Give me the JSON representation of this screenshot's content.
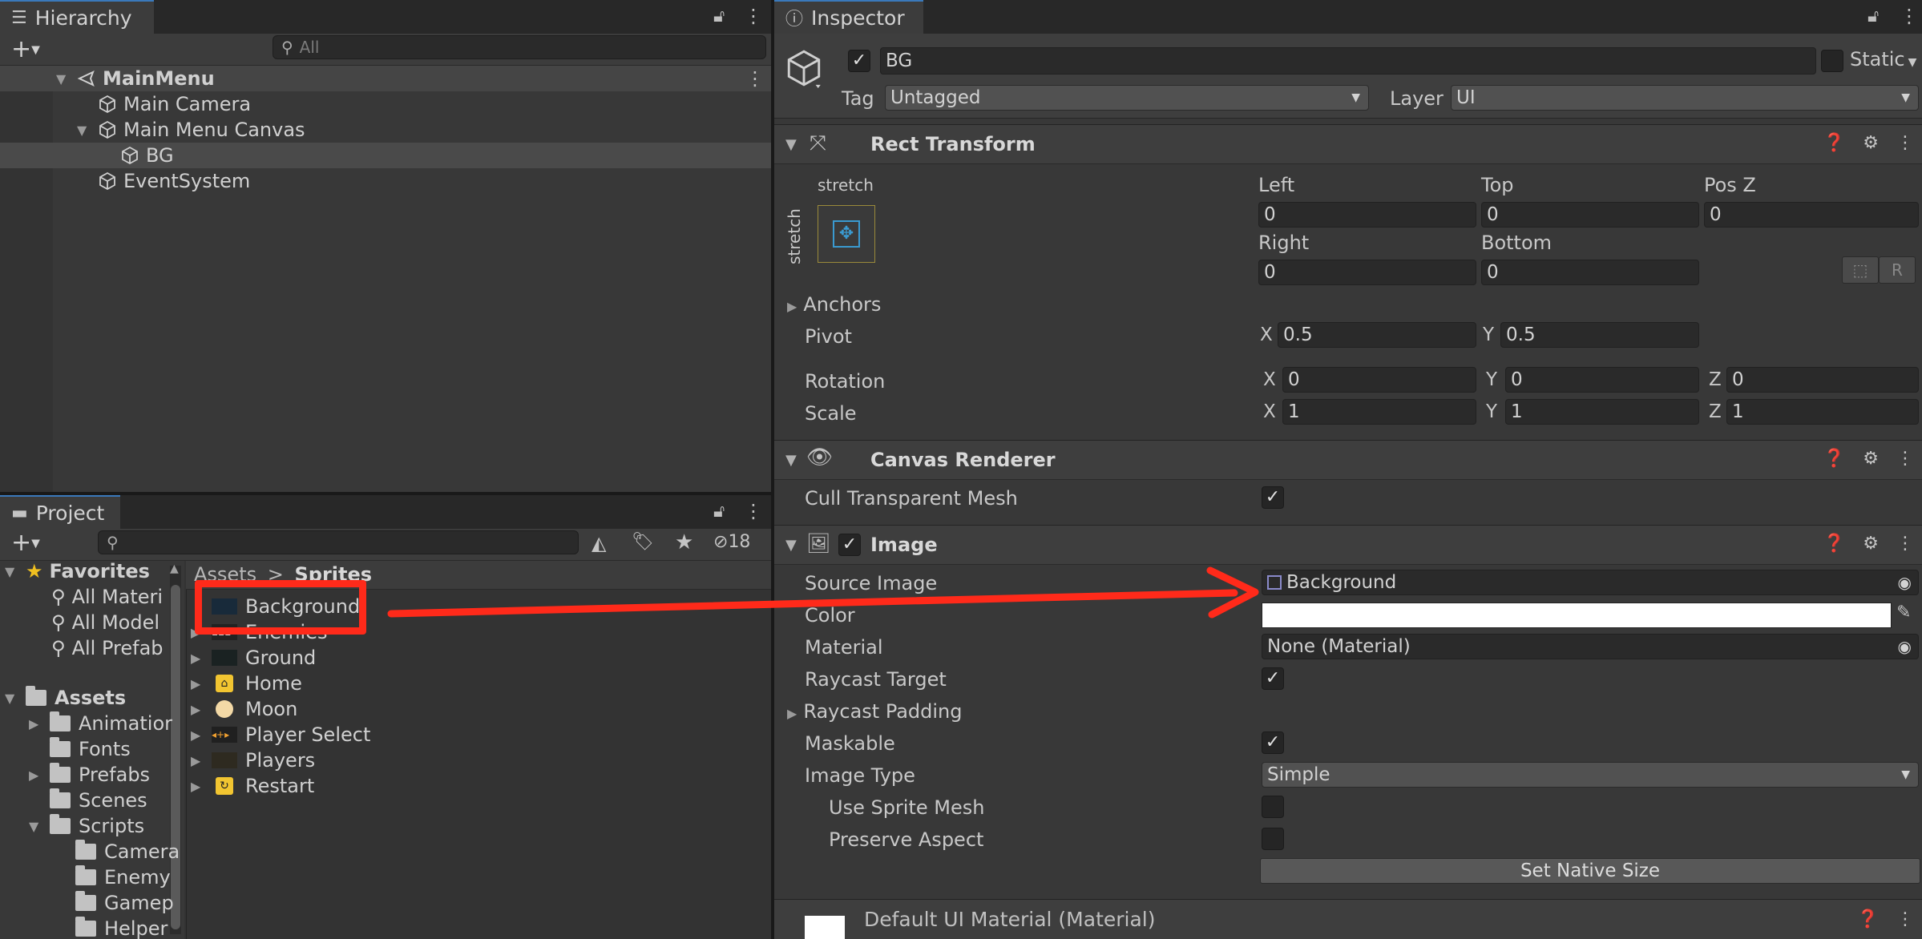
{
  "hierarchy": {
    "tab_label": "Hierarchy",
    "search_placeholder": "All",
    "items": [
      {
        "label": "MainMenu"
      },
      {
        "label": "Main Camera"
      },
      {
        "label": "Main Menu Canvas"
      },
      {
        "label": "BG"
      },
      {
        "label": "EventSystem"
      }
    ]
  },
  "project": {
    "tab_label": "Project",
    "hidden_count": "18",
    "favorites": {
      "label": "Favorites",
      "items": [
        "All Materi",
        "All Model",
        "All Prefab"
      ]
    },
    "assets": {
      "label": "Assets",
      "items": [
        "Animatior",
        "Fonts",
        "Prefabs",
        "Scenes",
        "Scripts",
        "Camera",
        "Enemy",
        "Gamep",
        "Helper"
      ]
    },
    "breadcrumb": {
      "root": "Assets",
      "sep": ">",
      "current": "Sprites"
    },
    "sprites": [
      "Background",
      "Enemies",
      "Ground",
      "Home",
      "Moon",
      "Player Select",
      "Players",
      "Restart"
    ]
  },
  "inspector": {
    "tab_label": "Inspector",
    "object_name": "BG",
    "static_label": "Static",
    "tag_label": "Tag",
    "tag_value": "Untagged",
    "layer_label": "Layer",
    "layer_value": "UI",
    "rect_transform": {
      "title": "Rect Transform",
      "anchor_h": "stretch",
      "anchor_v": "stretch",
      "left_label": "Left",
      "left": "0",
      "top_label": "Top",
      "top": "0",
      "posz_label": "Pos Z",
      "posz": "0",
      "right_label": "Right",
      "right": "0",
      "bottom_label": "Bottom",
      "bottom": "0",
      "r_button": "R",
      "anchors_label": "Anchors",
      "pivot_label": "Pivot",
      "pivot_x": "0.5",
      "pivot_y": "0.5",
      "rotation_label": "Rotation",
      "rot_x": "0",
      "rot_y": "0",
      "rot_z": "0",
      "scale_label": "Scale",
      "scale_x": "1",
      "scale_y": "1",
      "scale_z": "1",
      "x": "X",
      "y": "Y",
      "z": "Z"
    },
    "canvas_renderer": {
      "title": "Canvas Renderer",
      "cull_label": "Cull Transparent Mesh"
    },
    "image": {
      "title": "Image",
      "source_image_label": "Source Image",
      "source_image": "Background",
      "color_label": "Color",
      "material_label": "Material",
      "material": "None (Material)",
      "raycast_target_label": "Raycast Target",
      "raycast_padding_label": "Raycast Padding",
      "maskable_label": "Maskable",
      "image_type_label": "Image Type",
      "image_type": "Simple",
      "use_sprite_mesh_label": "Use Sprite Mesh",
      "preserve_aspect_label": "Preserve Aspect",
      "set_native_size": "Set Native Size"
    },
    "default_material": "Default UI Material (Material)"
  },
  "colors": {
    "accent": "#3a79bb",
    "annotation": "#ff2a1a",
    "panel": "#383838"
  }
}
